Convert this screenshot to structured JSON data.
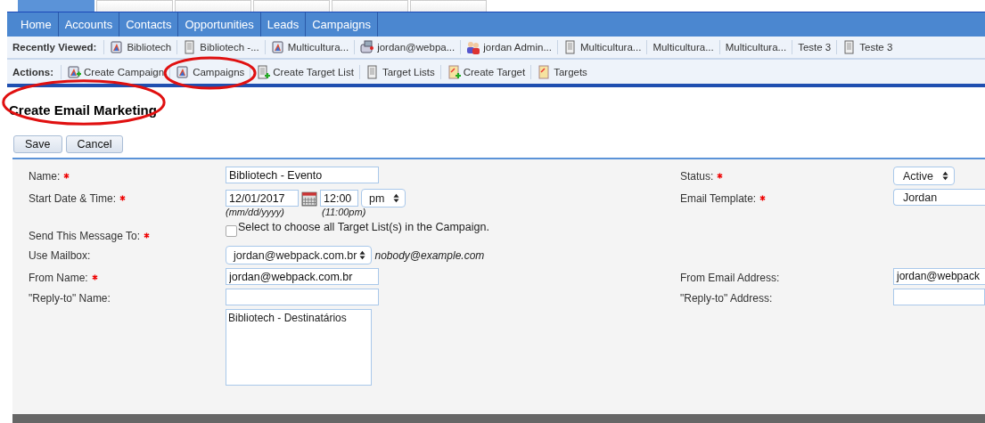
{
  "top_tabs": [
    {
      "selected": true
    },
    {
      "selected": false
    },
    {
      "selected": false
    },
    {
      "selected": false
    },
    {
      "selected": false
    },
    {
      "selected": false
    }
  ],
  "nav": [
    {
      "label": "Home",
      "selected": false
    },
    {
      "label": "Accounts",
      "selected": false
    },
    {
      "label": "Contacts",
      "selected": false
    },
    {
      "label": "Opportunities",
      "selected": false
    },
    {
      "label": "Leads",
      "selected": false
    },
    {
      "label": "Campaigns",
      "selected": false
    }
  ],
  "recently_viewed": {
    "label": "Recently Viewed:",
    "items": [
      {
        "label": "Bibliotech",
        "kind": "campaign"
      },
      {
        "label": "Bibliotech -...",
        "kind": "list"
      },
      {
        "label": "Multicultura...",
        "kind": "campaign"
      },
      {
        "label": "jordan@webpa...",
        "kind": "mailbox"
      },
      {
        "label": "jordan Admin...",
        "kind": "user"
      },
      {
        "label": "Multicultura...",
        "kind": "list"
      },
      {
        "label": "Multicultura...",
        "kind": "other"
      },
      {
        "label": "Multicultura...",
        "kind": "other"
      },
      {
        "label": "Teste 3",
        "kind": "other"
      },
      {
        "label": "Teste 3",
        "kind": "list"
      }
    ]
  },
  "actions": {
    "label": "Actions:",
    "items": [
      {
        "label": "Create Campaign",
        "kind": "create",
        "circled": false
      },
      {
        "label": "Campaigns",
        "kind": "view",
        "circled": true
      },
      {
        "label": "Create Target List",
        "kind": "create",
        "circled": false
      },
      {
        "label": "Target Lists",
        "kind": "view",
        "circled": false
      },
      {
        "label": "Create Target",
        "kind": "create",
        "circled": false
      },
      {
        "label": "Targets",
        "kind": "view",
        "circled": false
      }
    ]
  },
  "title": {
    "text": "Create Email Marketing",
    "circled": true
  },
  "buttons": [
    "Save",
    "Cancel"
  ],
  "form": {
    "name": {
      "label": "Name:",
      "required": true,
      "value": "Bibliotech - Evento"
    },
    "start": {
      "label": "Start Date & Time:",
      "required": true,
      "date": "12/01/2017",
      "time": "12:00",
      "ampm": "pm",
      "date_hint": "(mm/dd/yyyy)",
      "time_hint": "(11:00pm)"
    },
    "send_to": {
      "label": "Send This Message To:",
      "required": true,
      "checkbox_label": "Select to choose all Target List(s) in the Campaign.",
      "checked": false,
      "list": [
        "Bibliotech - Destinatários"
      ]
    },
    "mailbox": {
      "label": "Use Mailbox:",
      "required": false,
      "value": "jordan@webpack.com.br",
      "note": "nobody@example.com"
    },
    "from_name": {
      "label": "From Name:",
      "required": true,
      "value": "jordan@webpack.com.br"
    },
    "reply_name": {
      "label": "\"Reply-to\" Name:",
      "required": false
    },
    "status": {
      "label": "Status:",
      "required": true,
      "value": "Active"
    },
    "template": {
      "label": "Email Template:",
      "required": true,
      "value": "Jordan"
    },
    "from_email": {
      "label": "From Email Address:",
      "required": false,
      "value": "jordan@webpack"
    },
    "reply_email": {
      "label": "\"Reply-to\" Address:",
      "required": false
    }
  }
}
